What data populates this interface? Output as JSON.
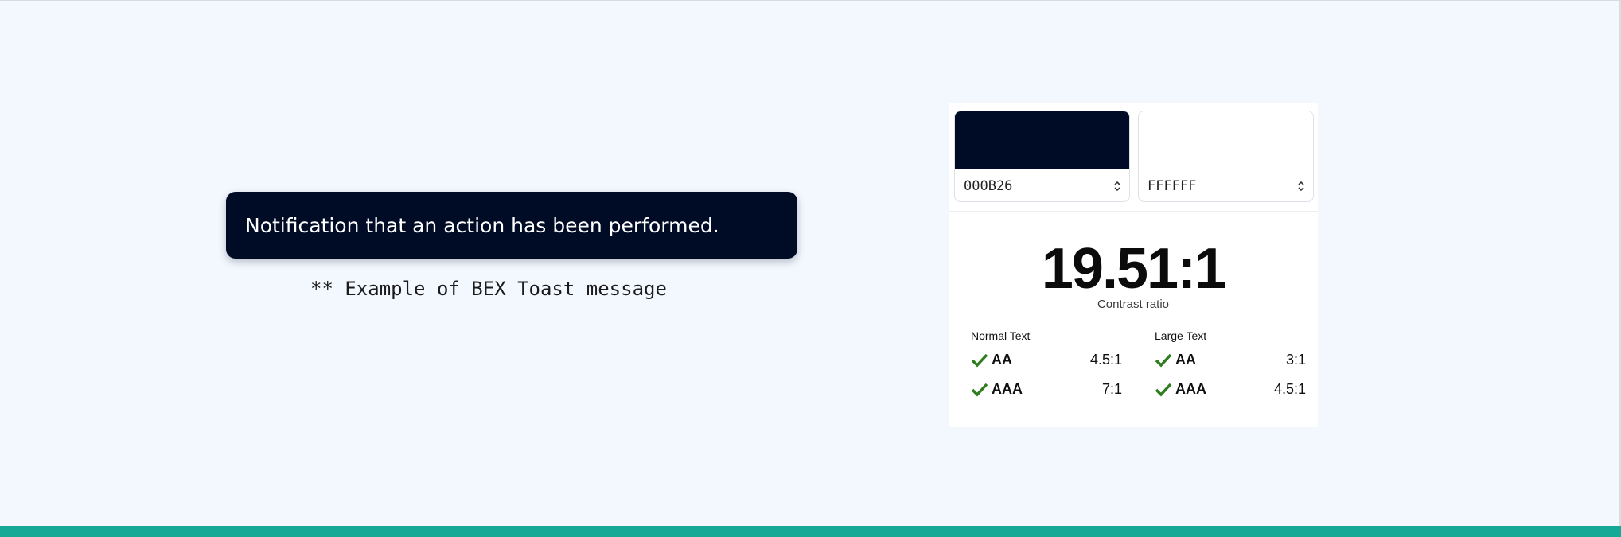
{
  "toast": {
    "message": "Notification that an action has been performed."
  },
  "caption": "** Example of BEX Toast message",
  "contrast": {
    "foreground": {
      "hex": "000B26",
      "color": "#000b26"
    },
    "background": {
      "hex": "FFFFFF",
      "color": "#ffffff"
    },
    "ratio": "19.51:1",
    "ratio_label": "Contrast ratio",
    "normal": {
      "title": "Normal Text",
      "rows": [
        {
          "level": "AA",
          "requirement": "4.5:1",
          "pass": true
        },
        {
          "level": "AAA",
          "requirement": "7:1",
          "pass": true
        }
      ]
    },
    "large": {
      "title": "Large Text",
      "rows": [
        {
          "level": "AA",
          "requirement": "3:1",
          "pass": true
        },
        {
          "level": "AAA",
          "requirement": "4.5:1",
          "pass": true
        }
      ]
    }
  },
  "colors": {
    "accent_bar": "#14a896",
    "pass_check": "#2e7d1e"
  }
}
